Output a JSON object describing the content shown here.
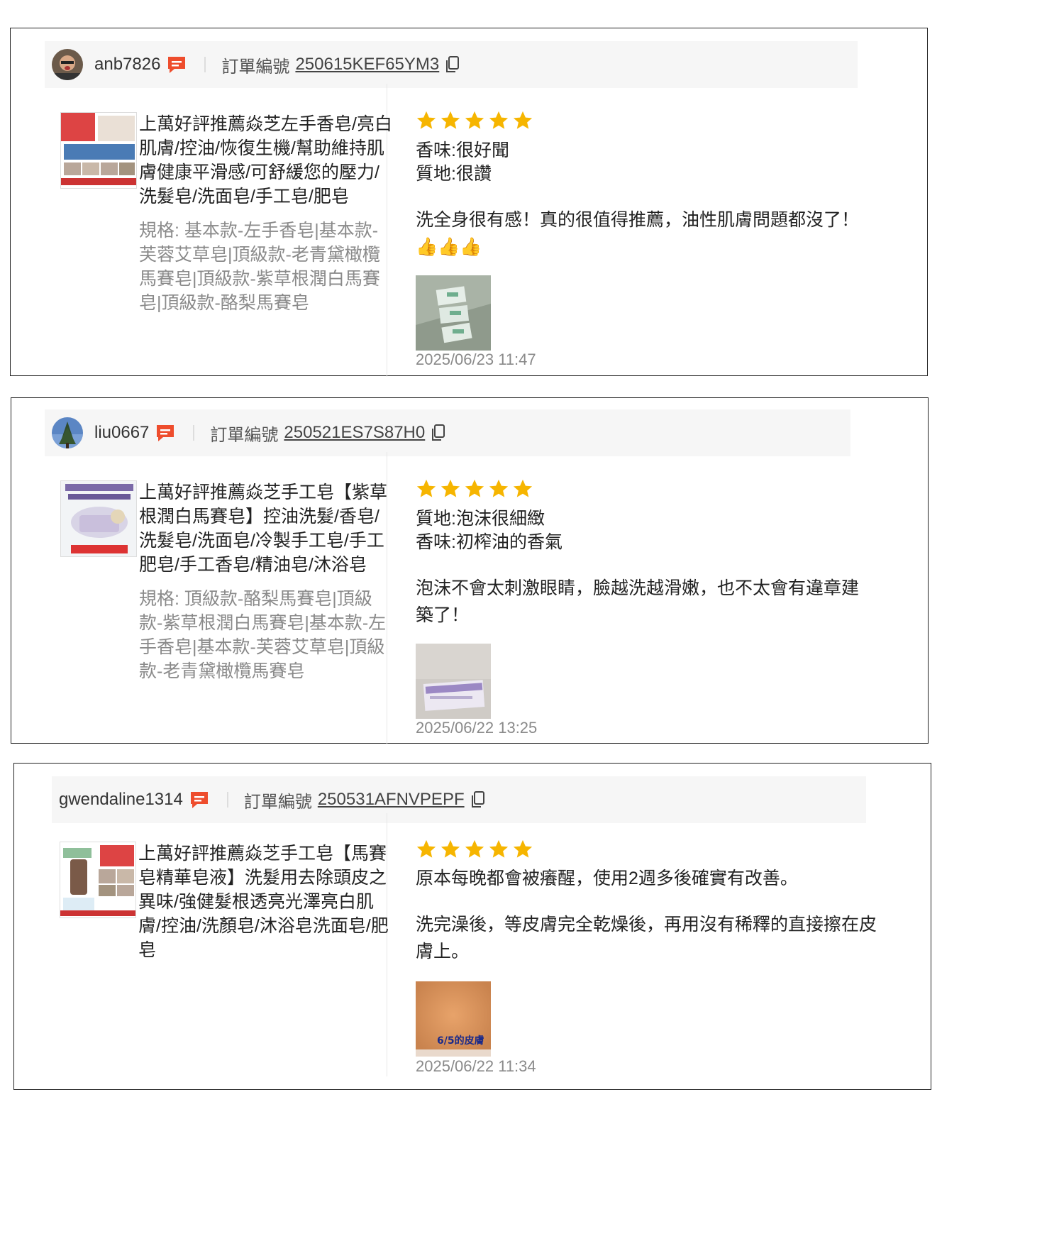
{
  "reviews": [
    {
      "username": "anb7826",
      "order_label": "訂單編號",
      "order_number": "250615KEF65YM3",
      "product_title": "上萬好評推薦焱芝左手香皂/亮白肌膚/控油/恢復生機/幫助維持肌膚健康平滑感/可舒緩您的壓力/洗髮皂/洗面皂/手工皂/肥皂",
      "spec": "規格: 基本款-左手香皂|基本款-芙蓉艾草皂|頂級款-老青黛橄欖馬賽皂|頂級款-紫草根潤白馬賽皂|頂級款-酪梨馬賽皂",
      "rating": 5,
      "attr1": "香味:很好聞",
      "attr2": "質地:很讚",
      "comment": "洗全身很有感！真的很值得推薦，油性肌膚問題都沒了！👍👍👍",
      "date": "2025/06/23 11:47"
    },
    {
      "username": "liu0667",
      "order_label": "訂單編號",
      "order_number": "250521ES7S87H0",
      "product_title": "上萬好評推薦焱芝手工皂【紫草根潤白馬賽皂】控油洗髮/香皂/洗髮皂/洗面皂/冷製手工皂/手工肥皂/手工香皂/精油皂/沐浴皂",
      "spec": "規格: 頂級款-酪梨馬賽皂|頂級款-紫草根潤白馬賽皂|基本款-左手香皂|基本款-芙蓉艾草皂|頂級款-老青黛橄欖馬賽皂",
      "rating": 5,
      "attr1": "質地:泡沫很細緻",
      "attr2": "香味:初榨油的香氣",
      "comment": "泡沫不會太刺激眼睛，臉越洗越滑嫩，也不太會有違章建築了！",
      "date": "2025/06/22 13:25"
    },
    {
      "username": "gwendaline1314",
      "order_label": "訂單編號",
      "order_number": "250531AFNVPEPF",
      "product_title": "上萬好評推薦焱芝手工皂【馬賽皂精華皂液】洗髮用去除頭皮之異味/強健髮根透亮光澤亮白肌膚/控油/洗顏皂/沐浴皂洗面皂/肥皂",
      "rating": 5,
      "attr1": "原本每晚都會被癢醒，使用2週多後確實有改善。",
      "comment": "洗完澡後，等皮膚完全乾燥後，再用沒有稀釋的直接擦在皮膚上。",
      "photo_caption": "6/5的皮膚",
      "date": "2025/06/22 11:34"
    }
  ],
  "colors": {
    "star": "#f6b500",
    "chat": "#ee4d2d",
    "border": "#222222",
    "muted": "#8a8a8a"
  }
}
